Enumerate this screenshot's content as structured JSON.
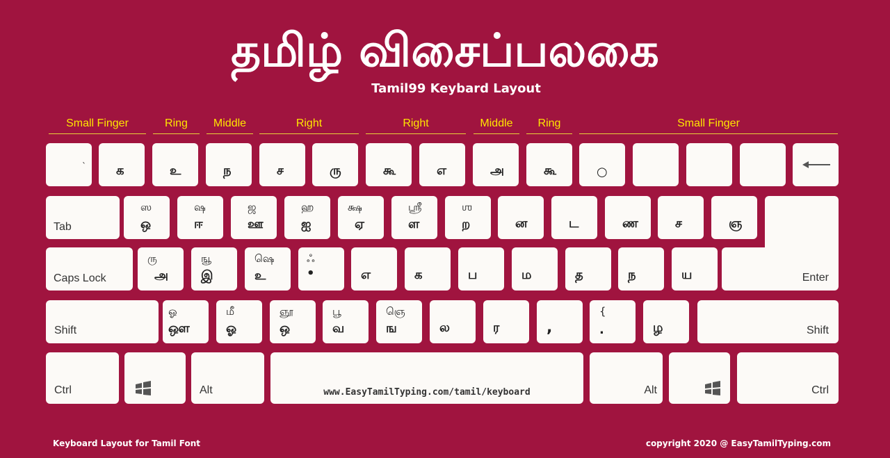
{
  "header": {
    "title": "தமிழ் விசைப்பலகை",
    "subtitle": "Tamil99 Keybard Layout"
  },
  "fingers": [
    "Small Finger",
    "Ring",
    "Middle",
    "Right",
    "Right",
    "Middle",
    "Ring",
    "Small Finger"
  ],
  "row1": [
    {
      "main": "`"
    },
    {
      "main": "க"
    },
    {
      "main": "உ"
    },
    {
      "main": "ந"
    },
    {
      "main": "ச"
    },
    {
      "main": "ரு"
    },
    {
      "main": "கூ"
    },
    {
      "main": "எ"
    },
    {
      "main": "அ"
    },
    {
      "main": "கூ"
    },
    {
      "main": "○"
    },
    {
      "main": ""
    },
    {
      "main": ""
    },
    {
      "main": ""
    }
  ],
  "row2": [
    {
      "label": "Tab"
    },
    {
      "shift": "ஸ",
      "main": "ஒ"
    },
    {
      "shift": "ஷ",
      "main": "ஈ"
    },
    {
      "shift": "ஜ",
      "main": "ஊ"
    },
    {
      "shift": "ஹ",
      "main": "ஐ"
    },
    {
      "shift": "க்ஷ",
      "main": "ஏ"
    },
    {
      "shift": "ஸ்ரீ",
      "main": "ள"
    },
    {
      "shift": "ஶ",
      "main": "ற"
    },
    {
      "main": "ன"
    },
    {
      "main": "ட"
    },
    {
      "main": "ண"
    },
    {
      "main": "ச"
    },
    {
      "main": "ஞ"
    }
  ],
  "row3": [
    {
      "label": "Caps Lock"
    },
    {
      "shift": "ரு",
      "main": "அ"
    },
    {
      "shift": "ஙூ",
      "main": "இ"
    },
    {
      "shift": "ஷெ",
      "main": "உ"
    },
    {
      "shift": "ஃ",
      "main": "•"
    },
    {
      "main": "எ"
    },
    {
      "main": "க"
    },
    {
      "main": "ப"
    },
    {
      "main": "ம"
    },
    {
      "main": "த"
    },
    {
      "main": "ந"
    },
    {
      "main": "ய"
    },
    {
      "label": "Enter"
    }
  ],
  "row4": [
    {
      "label": "Shift"
    },
    {
      "shift": "ஓ",
      "main": "ஔ"
    },
    {
      "shift": "மீ",
      "main": "ஓ"
    },
    {
      "shift": "ஞூ",
      "main": "ஒ"
    },
    {
      "shift": "பூ",
      "main": "வ"
    },
    {
      "shift": "ஞெ",
      "main": "ங"
    },
    {
      "main": "ல"
    },
    {
      "main": "ர"
    },
    {
      "main": ","
    },
    {
      "shift": "{",
      "main": "."
    },
    {
      "main": "ழ"
    },
    {
      "label": "Shift"
    }
  ],
  "row5": [
    {
      "label": "Ctrl"
    },
    {
      "icon": "windows-icon"
    },
    {
      "label": "Alt"
    },
    {
      "url": "www.EasyTamilTyping.com/tamil/keyboard"
    },
    {
      "label": "Alt"
    },
    {
      "icon": "windows-icon"
    },
    {
      "label": "Ctrl"
    }
  ],
  "footer": {
    "left": "Keyboard Layout for Tamil Font",
    "right": "copyright 2020 @ EasyTamilTyping.com"
  }
}
